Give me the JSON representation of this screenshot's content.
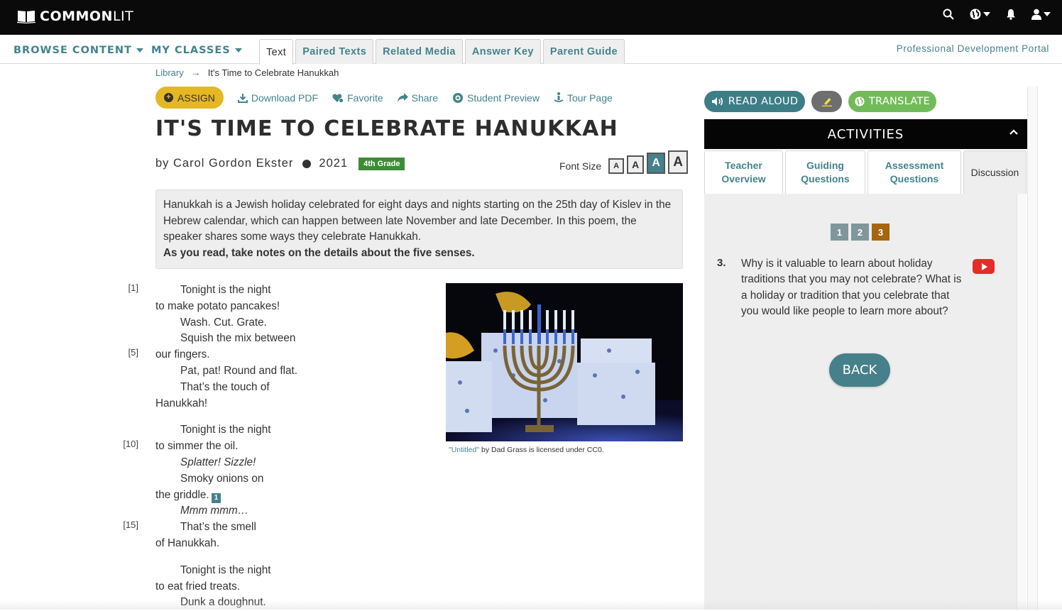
{
  "app": {
    "brand_bold": "COMMON",
    "brand_light": "LIT",
    "top_icons": [
      "search-icon",
      "globe-icon",
      "bell-icon",
      "user-icon"
    ]
  },
  "nav": {
    "browse_content": "BROWSE CONTENT",
    "my_classes": "MY CLASSES",
    "tabs": [
      {
        "label": "Text",
        "active": true
      },
      {
        "label": "Paired Texts",
        "active": false
      },
      {
        "label": "Related Media",
        "active": false
      },
      {
        "label": "Answer Key",
        "active": false
      },
      {
        "label": "Parent Guide",
        "active": false
      }
    ],
    "pd_portal": "Professional Development Portal"
  },
  "breadcrumb": {
    "library": "Library",
    "current": "It's Time to Celebrate Hanukkah"
  },
  "actions": {
    "assign": "ASSIGN",
    "download_pdf": "Download PDF",
    "favorite": "Favorite",
    "share": "Share",
    "student_preview": "Student Preview",
    "tour_page": "Tour Page"
  },
  "text": {
    "title": "IT'S TIME TO CELEBRATE HANUKKAH",
    "author": "by Carol Gordon Ekster",
    "year": "2021",
    "grade": "4th Grade",
    "font_size_label": "Font Size",
    "font_size_options": [
      "A",
      "A",
      "A",
      "A"
    ],
    "font_size_selected_index": 2,
    "intro": "Hanukkah is a Jewish holiday celebrated for eight days and nights starting on the 25th day of Kislev in the Hebrew calendar, which can happen between late November and late December. In this poem, the speaker shares some ways they celebrate Hanukkah.",
    "instruction": "As you read, take notes on the details about the five senses.",
    "poem_lines": [
      {
        "n": "[1]",
        "text": "Tonight is the night",
        "indent": true
      },
      {
        "n": "",
        "text": "to make potato pancakes!",
        "indent": false
      },
      {
        "n": "",
        "text": "Wash. Cut. Grate.",
        "indent": true
      },
      {
        "n": "",
        "text": "Squish the mix between",
        "indent": true
      },
      {
        "n": "[5]",
        "text": "our fingers.",
        "indent": false
      },
      {
        "n": "",
        "text": "Pat, pat! Round and flat.",
        "indent": true
      },
      {
        "n": "",
        "text": "That’s the touch of",
        "indent": true
      },
      {
        "n": "",
        "text": "Hanukkah!",
        "indent": false
      },
      {
        "n": "",
        "text": "Tonight is the night",
        "indent": true
      },
      {
        "n": "[10]",
        "text": "to simmer the oil.",
        "indent": false
      },
      {
        "n": "",
        "text": "Splatter! Sizzle!",
        "indent": true
      },
      {
        "n": "",
        "text": "Smoky onions on",
        "indent": true
      },
      {
        "n": "",
        "text": "the griddle.",
        "indent": false
      },
      {
        "n": "",
        "text": "Mmm mmm…",
        "indent": true
      },
      {
        "n": "[15]",
        "text": "That’s the smell",
        "indent": true
      },
      {
        "n": "",
        "text": "of Hanukkah.",
        "indent": false
      },
      {
        "n": "",
        "text": "Tonight is the night",
        "indent": true
      },
      {
        "n": "",
        "text": "to eat fried treats.",
        "indent": false
      },
      {
        "n": "",
        "text": "Dunk a doughnut.",
        "indent": true
      }
    ],
    "footnote_marker": "1",
    "image_caption_link": "\"Untitled\"",
    "image_caption_rest": " by Dad Grass is licensed under CC0."
  },
  "sidebar": {
    "read_aloud": "READ ALOUD",
    "translate": "TRANSLATE",
    "activities_title": "ACTIVITIES",
    "tabs": [
      {
        "label": "Teacher Overview",
        "active": false
      },
      {
        "label": "Guiding Questions",
        "active": false
      },
      {
        "label": "Assessment Questions",
        "active": false
      },
      {
        "label": "Discussion",
        "active": true
      }
    ],
    "question_pages": [
      "1",
      "2",
      "3"
    ],
    "current_page": "3",
    "question_number": "3.",
    "question_text": "Why is it valuable to learn about holiday traditions that you may not celebrate? What is a holiday or tradition that you celebrate that you would like people to learn more about?",
    "back": "BACK"
  },
  "colors": {
    "accent_teal": "#43838c",
    "assign_yellow": "#e5b723",
    "grade_green": "#3c8c35",
    "translate_green": "#72bb5a",
    "current_question": "#a6650f",
    "youtube_red": "#e52d27"
  }
}
